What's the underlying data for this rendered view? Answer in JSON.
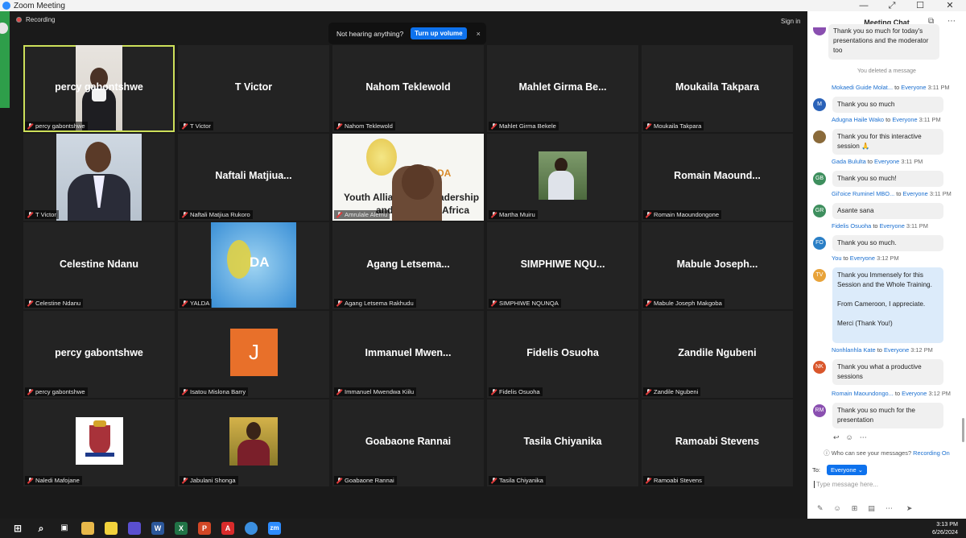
{
  "window": {
    "title": "Zoom Meeting",
    "controls": [
      "—",
      "⤢",
      "☐",
      "✕"
    ]
  },
  "recording": "Recording",
  "signin": "Sign in",
  "banner": {
    "text": "Not hearing anything?",
    "button": "Turn up volume",
    "close": "×"
  },
  "tiles": [
    {
      "name": "percy gabontshwe",
      "label": "percy gabontshwe",
      "video": "person-light"
    },
    {
      "name": "T Victor",
      "label": "T Victor"
    },
    {
      "name": "Nahom Teklewold",
      "label": "Nahom Teklewold"
    },
    {
      "name": "Mahlet Girma Be...",
      "label": "Mahlet Girma Bekele"
    },
    {
      "name": "Moukaila Takpara",
      "label": "Moukaila Takpara"
    },
    {
      "name": "",
      "label": "T Victor",
      "video": "person-suit"
    },
    {
      "name": "Naftali Matjiua...",
      "label": "Naftali Matjiua Rukoro"
    },
    {
      "name": "",
      "label": "Amrulale Alemu",
      "video": "yalda-banner"
    },
    {
      "name": "",
      "label": "Martha Muiru",
      "video": "outdoor"
    },
    {
      "name": "Romain Maound...",
      "label": "Romain Maoundongone"
    },
    {
      "name": "Celestine Ndanu",
      "label": "Celestine Ndanu"
    },
    {
      "name": "",
      "label": "YALDA",
      "video": "yalda-logo"
    },
    {
      "name": "Agang Letsema...",
      "label": "Agang Letsema Rakhudu"
    },
    {
      "name": "SIMPHIWE NQU...",
      "label": "SIMPHIWE NQUNQA"
    },
    {
      "name": "Mabule Joseph...",
      "label": "Mabule Joseph Makgoba"
    },
    {
      "name": "percy gabontshwe",
      "label": "percy gabontshwe"
    },
    {
      "name": "",
      "label": "Isatou Mislona Barry",
      "video": "letter-j"
    },
    {
      "name": "Immanuel Mwen...",
      "label": "Immanuel Mwendwa Kiilu"
    },
    {
      "name": "Fidelis Osuoha",
      "label": "Fidelis Osuoha"
    },
    {
      "name": "Zandile Ngubeni",
      "label": "Zandile Ngubeni"
    },
    {
      "name": "",
      "label": "Naledi Mafojane",
      "video": "crest"
    },
    {
      "name": "",
      "label": "Jabulani Shonga",
      "video": "portrait"
    },
    {
      "name": "Goabaone Rannai",
      "label": "Goabaone Rannai"
    },
    {
      "name": "Tasila Chiyanika",
      "label": "Tasila Chiyanika"
    },
    {
      "name": "Ramoabi Stevens",
      "label": "Ramoabi Stevens"
    }
  ],
  "yalda_banner": {
    "line1": "Youth Allian",
    "line1b": "Leadership",
    "line2": "and De",
    "line2b": "Africa",
    "brand": "DA"
  },
  "yalda_logo": "DA",
  "letter_j": "J",
  "chat": {
    "title": "Meeting Chat",
    "first_bubble": "Thank you so much for today's presentations and the moderator too",
    "deleted": "You deleted a message",
    "messages": [
      {
        "sender": "Mokaedi Guide Molat...",
        "to": "to",
        "target": "Everyone",
        "time": "3:11 PM",
        "initials": "M",
        "color": "#2a62b8",
        "text": "Thank you so much"
      },
      {
        "sender": "Adugna Haile Wako",
        "to": "to",
        "target": "Everyone",
        "time": "3:11 PM",
        "initials": "",
        "color": "#8a6a3a",
        "text": "Thank you for this interactive session 🙏"
      },
      {
        "sender": "Gada Bululta",
        "to": "to",
        "target": "Everyone",
        "time": "3:11 PM",
        "initials": "GB",
        "color": "#3e8f5e",
        "text": "Thank you so much!"
      },
      {
        "sender": "Gil'oice Ruminel MBO...",
        "to": "to",
        "target": "Everyone",
        "time": "3:11 PM",
        "initials": "GR",
        "color": "#3e8f5e",
        "text": "Asante sana"
      },
      {
        "sender": "Fidelis Osuoha",
        "to": "to",
        "target": "Everyone",
        "time": "3:11 PM",
        "initials": "FO",
        "color": "#2a7fc6",
        "text": "Thank you so much."
      },
      {
        "sender": "You",
        "to": "to",
        "target": "Everyone",
        "time": "3:12 PM",
        "initials": "TV",
        "color": "#e8a33a",
        "text": "Thank you Immensely for this Session and the Whole Training.",
        "text2": "From Cameroon, I appreciate.",
        "text3": "Merci (Thank You!)"
      },
      {
        "sender": "Nonhlanhla Kate",
        "to": "to",
        "target": "Everyone",
        "time": "3:12 PM",
        "initials": "NK",
        "color": "#d9562b",
        "text": "Thank you what a productive sessions"
      },
      {
        "sender": "Romain Maoundongo...",
        "to": "to",
        "target": "Everyone",
        "time": "3:12 PM",
        "initials": "RM",
        "color": "#8a4fb0",
        "text": "Thank you so much for the presentation"
      }
    ],
    "notice": "Who can see your messages?",
    "notice_link": "Recording On",
    "to_label": "To:",
    "to_target": "Everyone ⌄",
    "input_placeholder": "Type message here..."
  },
  "taskbar": {
    "time": "3:13 PM",
    "date": "6/26/2024"
  }
}
